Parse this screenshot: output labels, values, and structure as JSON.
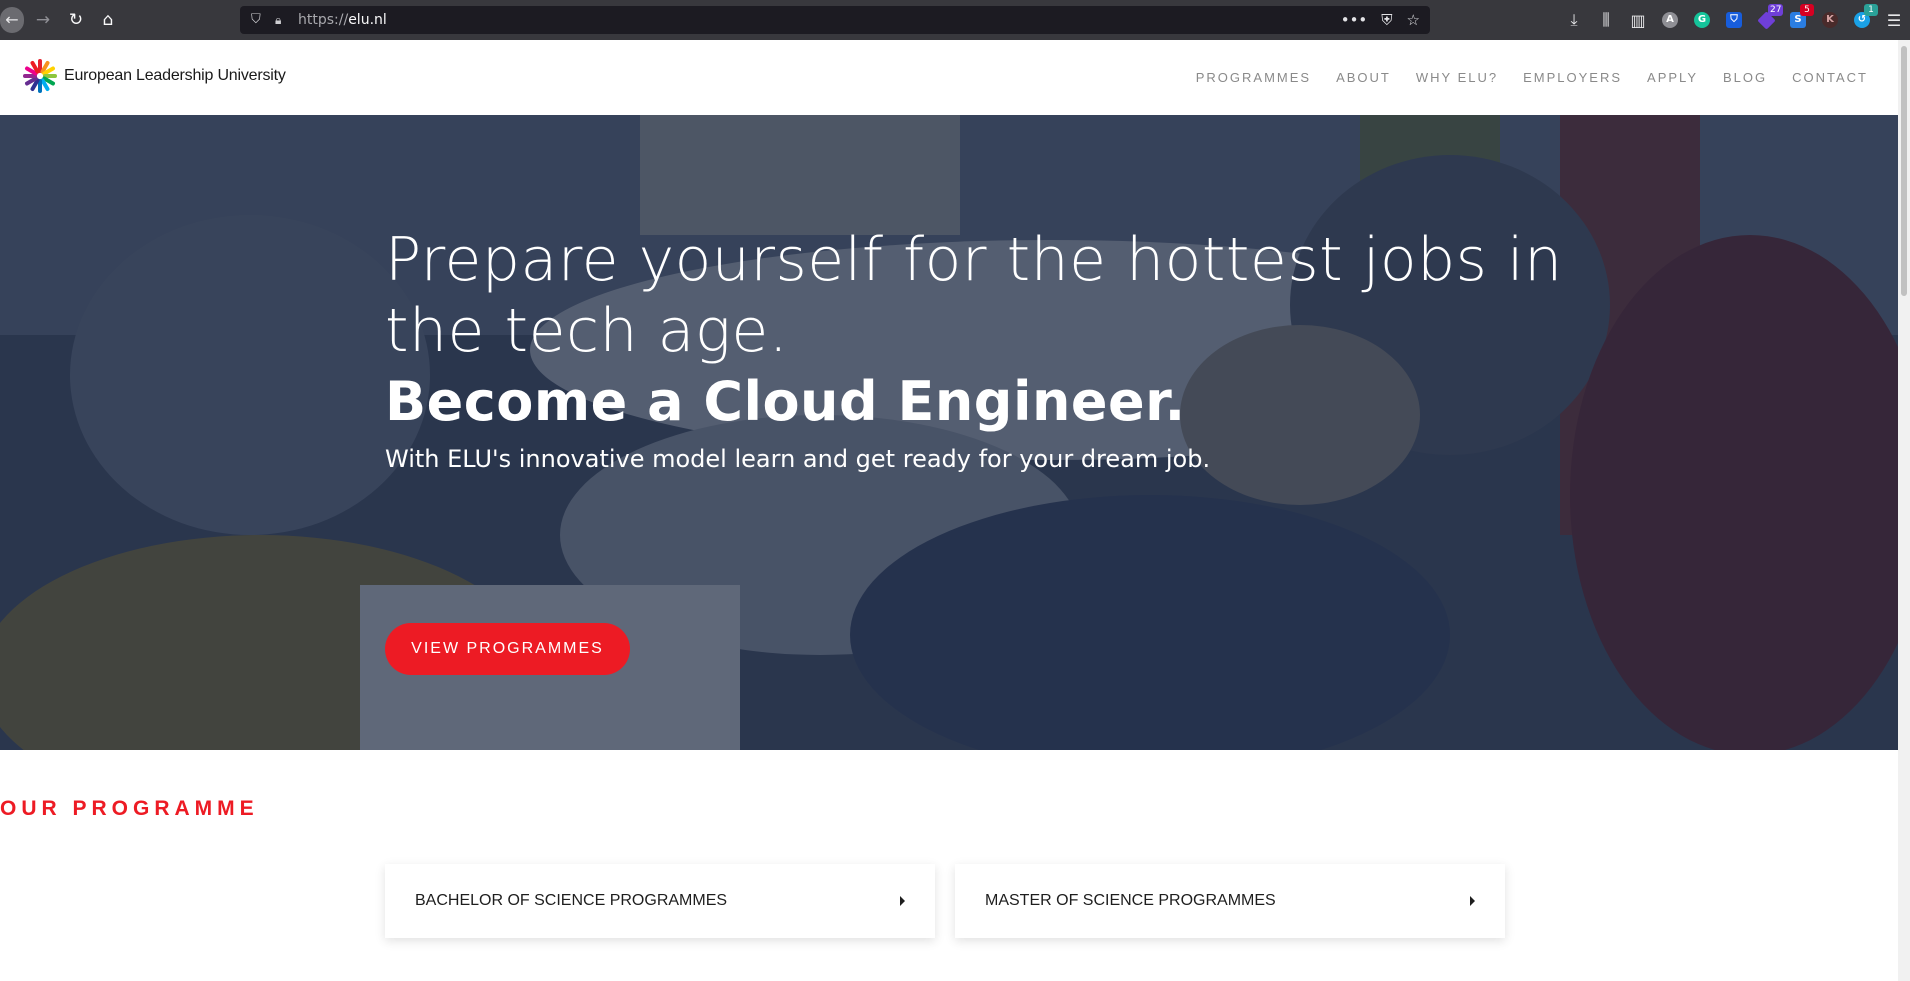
{
  "browser": {
    "url_prefix": "https://",
    "url_domain": "elu.nl",
    "badges": {
      "ext_purple": "27",
      "ext_red": "5",
      "ext_blue": "1"
    },
    "avatar_letter": "A",
    "ext_letter_k": "K"
  },
  "site": {
    "logo_text": "European Leadership University",
    "nav": [
      "PROGRAMMES",
      "ABOUT",
      "WHY ELU?",
      "EMPLOYERS",
      "APPLY",
      "BLOG",
      "CONTACT"
    ]
  },
  "hero": {
    "title": "Prepare yourself for the hottest jobs in the tech age.",
    "title2": "Become a  Cloud Engineer.",
    "subtitle": "With ELU's innovative model learn and get ready for your dream job.",
    "cta_label": "VIEW PROGRAMMES"
  },
  "programmes": {
    "section_title": "OUR PROGRAMME",
    "cards": [
      "BACHELOR OF SCIENCE PROGRAMMES",
      "MASTER OF SCIENCE PROGRAMMES"
    ]
  },
  "colors": {
    "accent": "#ed1b24",
    "hero_overlay": "#16233e",
    "chrome": "#38383d"
  }
}
